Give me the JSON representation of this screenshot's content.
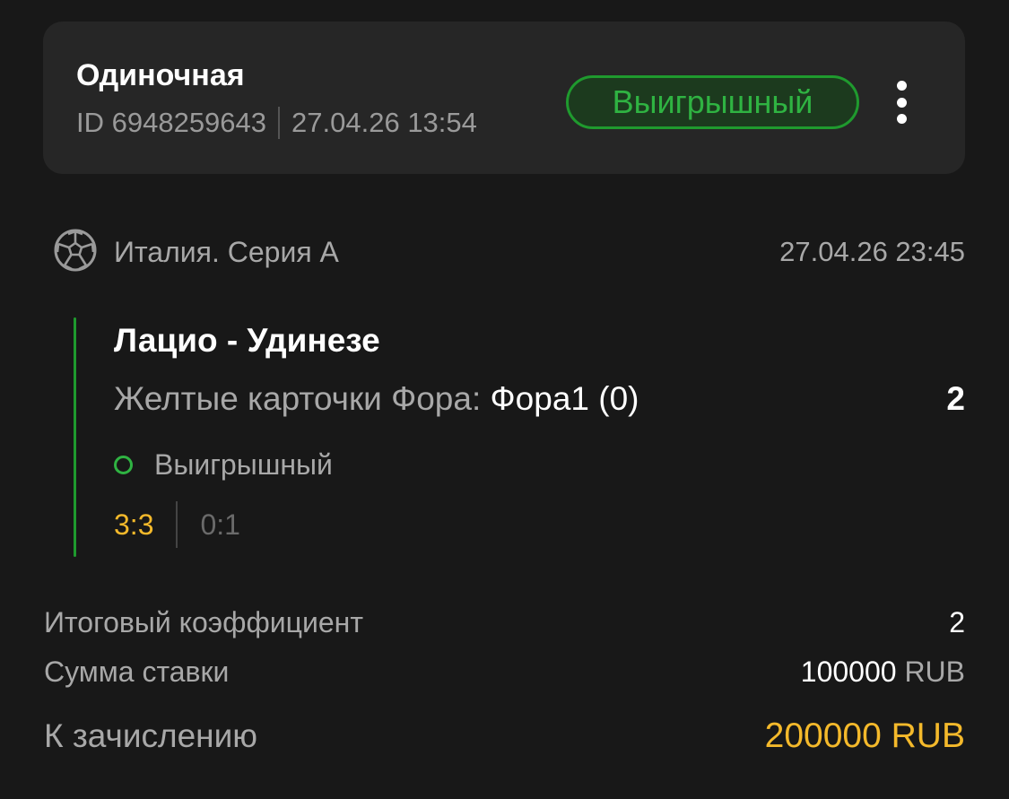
{
  "bet": {
    "type_label": "Одиночная",
    "id_text": "ID 6948259643",
    "placed_datetime": "27.04.26 13:54",
    "status": "Выигрышный",
    "more_icon": "more-vertical-icon"
  },
  "event": {
    "sport_icon": "soccer-ball-icon",
    "league": "Италия. Серия А",
    "datetime": "27.04.26 23:45",
    "teams": "Лацио - Удинезе",
    "market": "Желтые карточки Фора:",
    "outcome": "Фора1 (0)",
    "odds": "2",
    "outcome_status": "Выигрышный",
    "score_final": "3:3",
    "score_half": "0:1"
  },
  "summary": {
    "total_coef_label": "Итоговый коэффициент",
    "total_coef_value": "2",
    "stake_label": "Сумма ставки",
    "stake_amount": "100000",
    "stake_currency": "RUB",
    "payout_label": "К зачислению",
    "payout_value": "200000 RUB"
  },
  "colors": {
    "background": "#181818",
    "card": "#262626",
    "win_green": "#2fb342",
    "accent_yellow": "#f4b92b",
    "muted_text": "#a8a8a8"
  }
}
